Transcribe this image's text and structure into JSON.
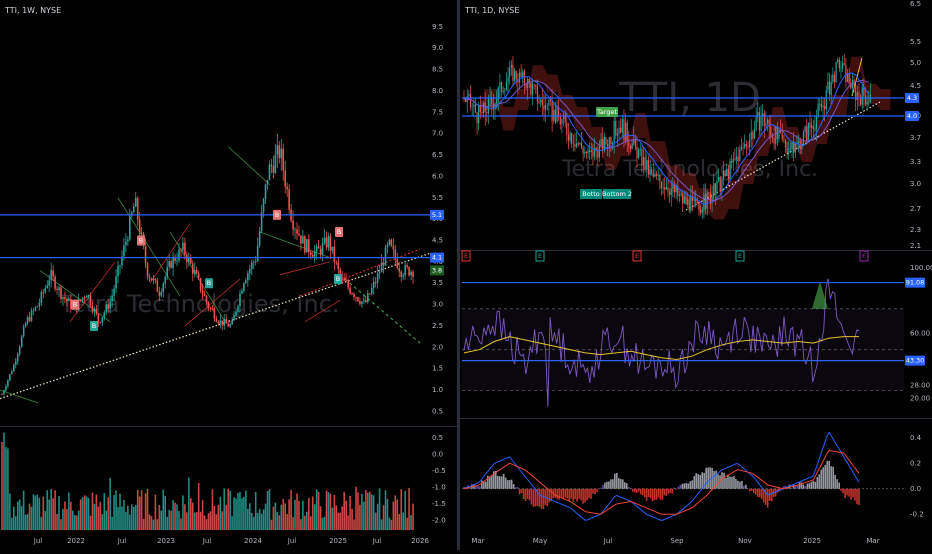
{
  "window": {
    "left_title": "TTI, 1W, NYSE",
    "right_title": "TTI, 1D, NYSE"
  },
  "colors": {
    "background": "#000000",
    "up_candle": "#26a69a",
    "down_candle": "#ef5350",
    "level_line": "#2962ff",
    "rsi": "#7e57c2",
    "rsi_ma": "#e6c229",
    "macd": "#2962ff",
    "signal": "#f44336",
    "cloud_green": "#4caf50",
    "cloud_red": "#e53935",
    "divider": "#2a2e39"
  },
  "watermark": {
    "left_company": "Tetra Technologies, Inc.",
    "right_symbol": "TTI, 1D"
  },
  "chart_data": [
    {
      "type": "candlestick",
      "pane": "weekly-price",
      "x_ticks": [
        "Jul",
        "2022",
        "Jul",
        "2023",
        "Jul",
        "2024",
        "Jul",
        "2025",
        "Jul",
        "2026"
      ],
      "y_ticks": [
        9.5,
        9.0,
        8.5,
        8.0,
        7.5,
        7.0,
        6.5,
        6.0,
        5.5,
        5.0,
        4.5,
        4.0,
        3.5,
        3.0,
        2.5,
        2.0,
        1.5,
        1.0,
        0.5
      ],
      "ylim": [
        0.3,
        9.8
      ],
      "levels": [
        {
          "label": "5.1",
          "value": 5.1
        },
        {
          "label": "4.1",
          "value": 4.1
        }
      ],
      "last_price": {
        "label": "3.8",
        "value": 3.8
      },
      "markers": [
        {
          "label": "B",
          "color": "red",
          "x_label": "2022-Jan"
        },
        {
          "label": "B",
          "color": "red",
          "x_label": "2022-Jul"
        },
        {
          "label": "B",
          "color": "red",
          "x_label": "2024-Mar"
        },
        {
          "label": "B",
          "color": "red",
          "x_label": "2025-Jan"
        },
        {
          "label": "B",
          "color": "green",
          "x_label": "2021-Jul"
        },
        {
          "label": "B",
          "color": "green",
          "x_label": "2023-Jul"
        },
        {
          "label": "B",
          "color": "green",
          "x_label": "2025-Jan"
        }
      ],
      "series": [
        {
          "values": [
            0.9,
            1.6,
            2.6,
            3.0,
            3.7,
            3.2,
            2.9,
            3.3,
            2.6,
            3.1,
            4.2,
            5.4,
            3.8,
            3.3,
            4.0,
            4.3,
            3.7,
            3.0,
            2.6,
            2.5,
            3.6,
            4.1,
            6.1,
            6.6,
            5.0,
            4.4,
            4.2,
            4.5,
            3.6,
            3.3,
            3.0,
            3.6,
            4.4,
            3.8,
            3.8
          ]
        }
      ]
    },
    {
      "type": "bar",
      "pane": "weekly-oscillator",
      "y_ticks": [
        0.5,
        0.0,
        -0.5,
        -1.0,
        -1.5,
        -2.0
      ],
      "ylim": [
        -2.2,
        0.8
      ]
    },
    {
      "type": "candlestick",
      "pane": "daily-price",
      "x_ticks": [
        "Mar",
        "May",
        "Jul",
        "Sep",
        "Nov",
        "2025",
        "Mar"
      ],
      "y_ticks": [
        6.5,
        5.5,
        5.0,
        4.5,
        4.0,
        3.7,
        3.3,
        3.0,
        2.7,
        2.3,
        2.1
      ],
      "levels": [
        {
          "label": "4.3",
          "value": 4.3
        },
        {
          "label": "4.0",
          "value": 4.0
        }
      ],
      "annotations": [
        {
          "label": "Target"
        },
        {
          "label": "Botto"
        },
        {
          "label": "Bottom 2"
        }
      ],
      "event_markers": [
        "E",
        "E",
        "E",
        "E",
        "E"
      ],
      "series": [
        {
          "values": [
            4.3,
            4.0,
            4.3,
            4.8,
            4.6,
            4.2,
            4.0,
            3.7,
            3.4,
            3.6,
            3.9,
            3.5,
            3.1,
            3.0,
            2.8,
            2.7,
            2.9,
            3.2,
            3.6,
            4.0,
            3.7,
            3.5,
            3.8,
            4.2,
            5.0,
            4.4,
            4.3
          ]
        }
      ]
    },
    {
      "type": "line",
      "pane": "daily-rsi",
      "y_ticks": [
        100.0,
        60.0,
        28.0,
        20.0
      ],
      "ylim": [
        10,
        100
      ],
      "levels": [
        {
          "label": "91.08",
          "value": 91.08
        },
        {
          "label": "43.30",
          "value": 43.3
        }
      ],
      "series": [
        {
          "values": [
            52,
            60,
            68,
            55,
            40,
            62,
            58,
            45,
            35,
            50,
            60,
            48,
            38,
            42,
            36,
            55,
            62,
            50,
            65,
            58,
            48,
            60,
            55,
            40,
            88,
            60,
            52
          ]
        },
        {
          "values": [
            48,
            50,
            55,
            58,
            56,
            54,
            52,
            50,
            48,
            47,
            48,
            49,
            47,
            45,
            44,
            46,
            50,
            53,
            55,
            56,
            55,
            54,
            55,
            54,
            57,
            58,
            58
          ]
        }
      ]
    },
    {
      "type": "line",
      "pane": "daily-macd",
      "y_ticks": [
        0.4,
        0.2,
        0.0,
        -0.2
      ],
      "ylim": [
        -0.3,
        0.5
      ],
      "series": [
        {
          "values": [
            0.0,
            0.05,
            0.2,
            0.25,
            0.1,
            -0.05,
            -0.1,
            -0.15,
            -0.25,
            -0.2,
            -0.05,
            -0.1,
            -0.2,
            -0.25,
            -0.2,
            -0.1,
            0.05,
            0.15,
            0.2,
            0.1,
            -0.05,
            0.0,
            0.05,
            0.1,
            0.45,
            0.25,
            0.05
          ]
        },
        {
          "values": [
            0.0,
            0.03,
            0.12,
            0.2,
            0.15,
            0.05,
            -0.05,
            -0.1,
            -0.18,
            -0.2,
            -0.12,
            -0.1,
            -0.15,
            -0.2,
            -0.2,
            -0.15,
            -0.05,
            0.08,
            0.15,
            0.12,
            0.03,
            0.0,
            0.03,
            0.07,
            0.3,
            0.28,
            0.12
          ]
        }
      ]
    }
  ]
}
